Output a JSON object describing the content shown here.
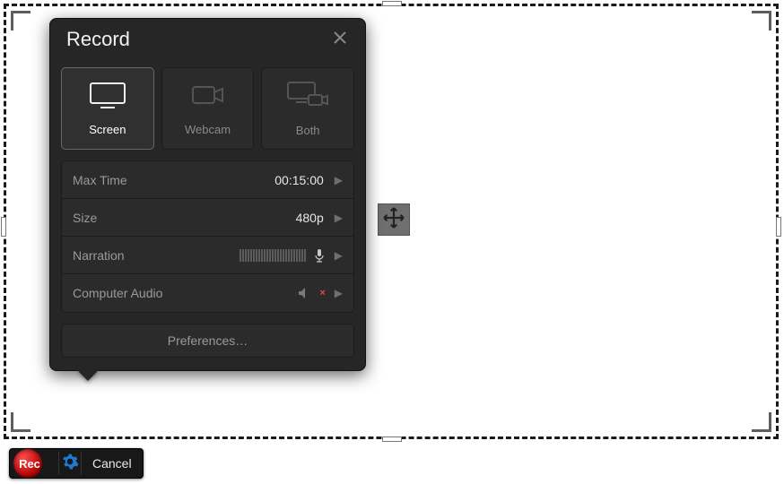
{
  "panel": {
    "title": "Record",
    "modes": {
      "screen": "Screen",
      "webcam": "Webcam",
      "both": "Both",
      "selected": "screen"
    },
    "settings": {
      "max_time": {
        "label": "Max Time",
        "value": "00:15:00"
      },
      "size": {
        "label": "Size",
        "value": "480p"
      },
      "narration": {
        "label": "Narration"
      },
      "computer_audio": {
        "label": "Computer Audio",
        "muted": true
      }
    },
    "preferences_label": "Preferences…"
  },
  "toolbar": {
    "rec_label": "Rec",
    "cancel_label": "Cancel"
  },
  "icons": {
    "close": "close-icon",
    "gear": "gear-icon",
    "move": "move-icon",
    "mic": "microphone-icon",
    "speaker_muted": "speaker-muted-icon",
    "chevron_right": "chevron-right-icon",
    "screen": "screen-icon",
    "webcam": "webcam-icon",
    "both": "screen-webcam-icon"
  },
  "colors": {
    "panel_bg": "#262626",
    "rec_red": "#c21414",
    "gear_blue": "#1f7ad1"
  }
}
